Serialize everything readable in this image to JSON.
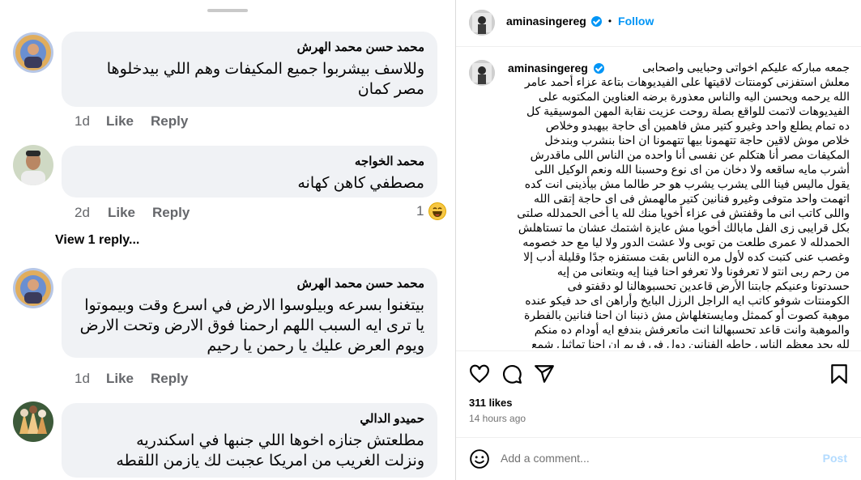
{
  "comments": [
    {
      "name": "محمد حسن محمد الهرش",
      "text": "وللاسف بيشربوا جميع المكيفات وهم اللي بيدخلوها مصر كمان",
      "time": "1d",
      "like": "Like",
      "reply": "Reply"
    },
    {
      "name": "محمد الخواجه",
      "text": "مصطفي كاهن كهانه",
      "time": "2d",
      "like": "Like",
      "reply": "Reply",
      "reaction_count": "1"
    },
    {
      "name": "محمد حسن محمد الهرش",
      "text": "بيتغنوا بسرعه وبيلوسوا الارض في اسرع وقت وبيموتوا يا ترى ايه السبب اللهم ارحمنا فوق الارض وتحت الارض ويوم العرض عليك يا رحمن يا رحيم",
      "time": "1d",
      "like": "Like",
      "reply": "Reply"
    },
    {
      "name": "حميدو الدالي",
      "text": "مطلعتش جنازه اخوها اللي جنبها في اسكندريه ونزلت الغريب من امريكا عجبت لك يازمن اللقطه"
    }
  ],
  "view_replies": "View 1 reply...",
  "post": {
    "username": "aminasingereg",
    "separator": "•",
    "follow": "Follow",
    "caption": "جمعه مباركه عليكم اخواتى وحبايبى واصحابى\nمعلش استفزنى كومنتات لاقيتها على الفيديوهات بتاعة عزاء أحمد عامر\nالله يرحمه ويحسن اليه والناس معذورة برضه العناوين المكتوبه على\nالفيديوهات لاتمت للواقع بصلة روحت عزيت نقابة المهن الموسيقية كل\nده تمام يطلع واحد وغيرو كتير مش فاهمين أى حاجة بيهبدو وخلاص\nخلاص موش لاقين حاجة تتهمونا بيها تتهمونا ان احنا بنشرب وبندخل\nالمكيفات مصر أنا هتكلم عن نفسى أنا واحده من الناس اللى ماقدرش\nأشرب مايه ساقعه ولا دخان من اى نوع وحسبنا الله ونعم الوكيل اللى\nيقول ماليس فينا اللى يشرب يشرب هو حر طالما مش بيأذينى انت كده\nاتهمت واحد متوفى وغيرو فنانين كتير مالهمش فى اى حاجة إتقى الله\nواللى كاتب انى ما وقفتش فى عزاء أخويا منك لله يا أخى الحمدلله صلتى\nبكل قرايبى زى الفل مابالك أخويا مش عايزة اشتمك عشان ما تستاهلش\nالحمدلله لا عمرى طلعت من توبى ولا عشت الدور ولا ليا مع حد خصومه\nوغصب عنى كتبت كده لأول مره الناس بقت مستفزه جدًا وقليلة أدب إلا\nمن رحم ربى انتو لا تعرفونا ولا تعرفو احنا فينا إيه وبتعانى من إيه\nحسدتونا وعنيكم جابتنا الأرض قاعدين تحسبوهالنا لو دقفتو فى\nالكومنتات شوفو كاتب ايه الراجل الرزل البايخ وأراهن اى حد فيكو عنده\nموهبة كصوت أو كممثل ومايستغلهاش مش ذنبنا ان احنا فنانين بالفطرة\nوالموهبة وانت قاعد تحسبهالنا انت ماتعرفش بندفع ايه أودام ده منكم\nلله يجد معظم الناس حاطه الفنانين دول فى فريم ان احنا تماثيل شمع",
    "likes": "311 likes",
    "time": "14 hours ago",
    "comment_placeholder": "Add a comment...",
    "post_label": "Post"
  },
  "colors": {
    "link_blue": "#0095f6",
    "bubble_bg": "#f0f2f5",
    "muted_gray": "#65676b",
    "post_disabled": "#b3dbff"
  },
  "icons": [
    "heart-icon",
    "comment-icon",
    "share-icon",
    "bookmark-icon",
    "emoji-icon",
    "haha-reaction-icon",
    "verified-badge-icon"
  ]
}
